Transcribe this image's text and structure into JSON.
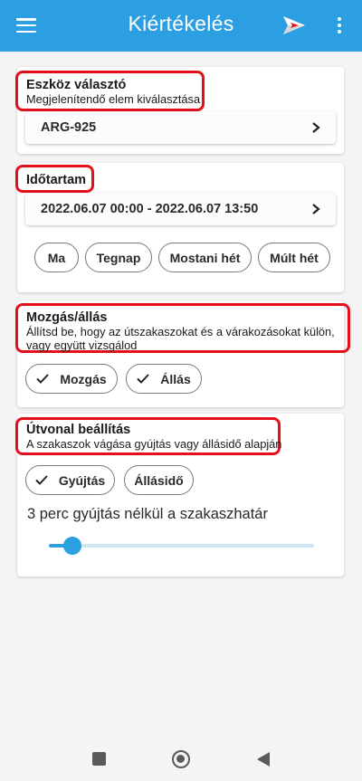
{
  "appbar": {
    "title": "Kiértékelés",
    "bg_color": "#2c9ee2",
    "icons": [
      "menu-icon",
      "send-icon",
      "more-vert-icon"
    ]
  },
  "device_section": {
    "title": "Eszköz választó",
    "subtitle": "Megjelenítendő elem kiválasztása",
    "selected": "ARG-925"
  },
  "duration_section": {
    "title": "Időtartam",
    "range": "2022.06.07 00:00 - 2022.06.07 13:50",
    "chips": [
      "Ma",
      "Tegnap",
      "Mostani hét",
      "Múlt hét"
    ]
  },
  "motion_section": {
    "title": "Mozgás/állás",
    "subtitle_line1": "Állítsd be, hogy az útszakaszokat és a várakozásokat külön,",
    "subtitle_line2": "vagy együtt vizsgálod",
    "chips": [
      {
        "label": "Mozgás",
        "selected": true
      },
      {
        "label": "Állás",
        "selected": true
      }
    ]
  },
  "route_section": {
    "title": "Útvonal beállítás",
    "subtitle": "A szakaszok vágása gyújtás vagy állásidő alapján",
    "chips": [
      {
        "label": "Gyújtás",
        "selected": true
      },
      {
        "label": "Állásidő",
        "selected": false
      }
    ],
    "slider_label": "3 perc gyújtás nélkül a szakaszhatár",
    "slider_value_fraction": 0.09
  },
  "highlight_color": "#e3101c"
}
